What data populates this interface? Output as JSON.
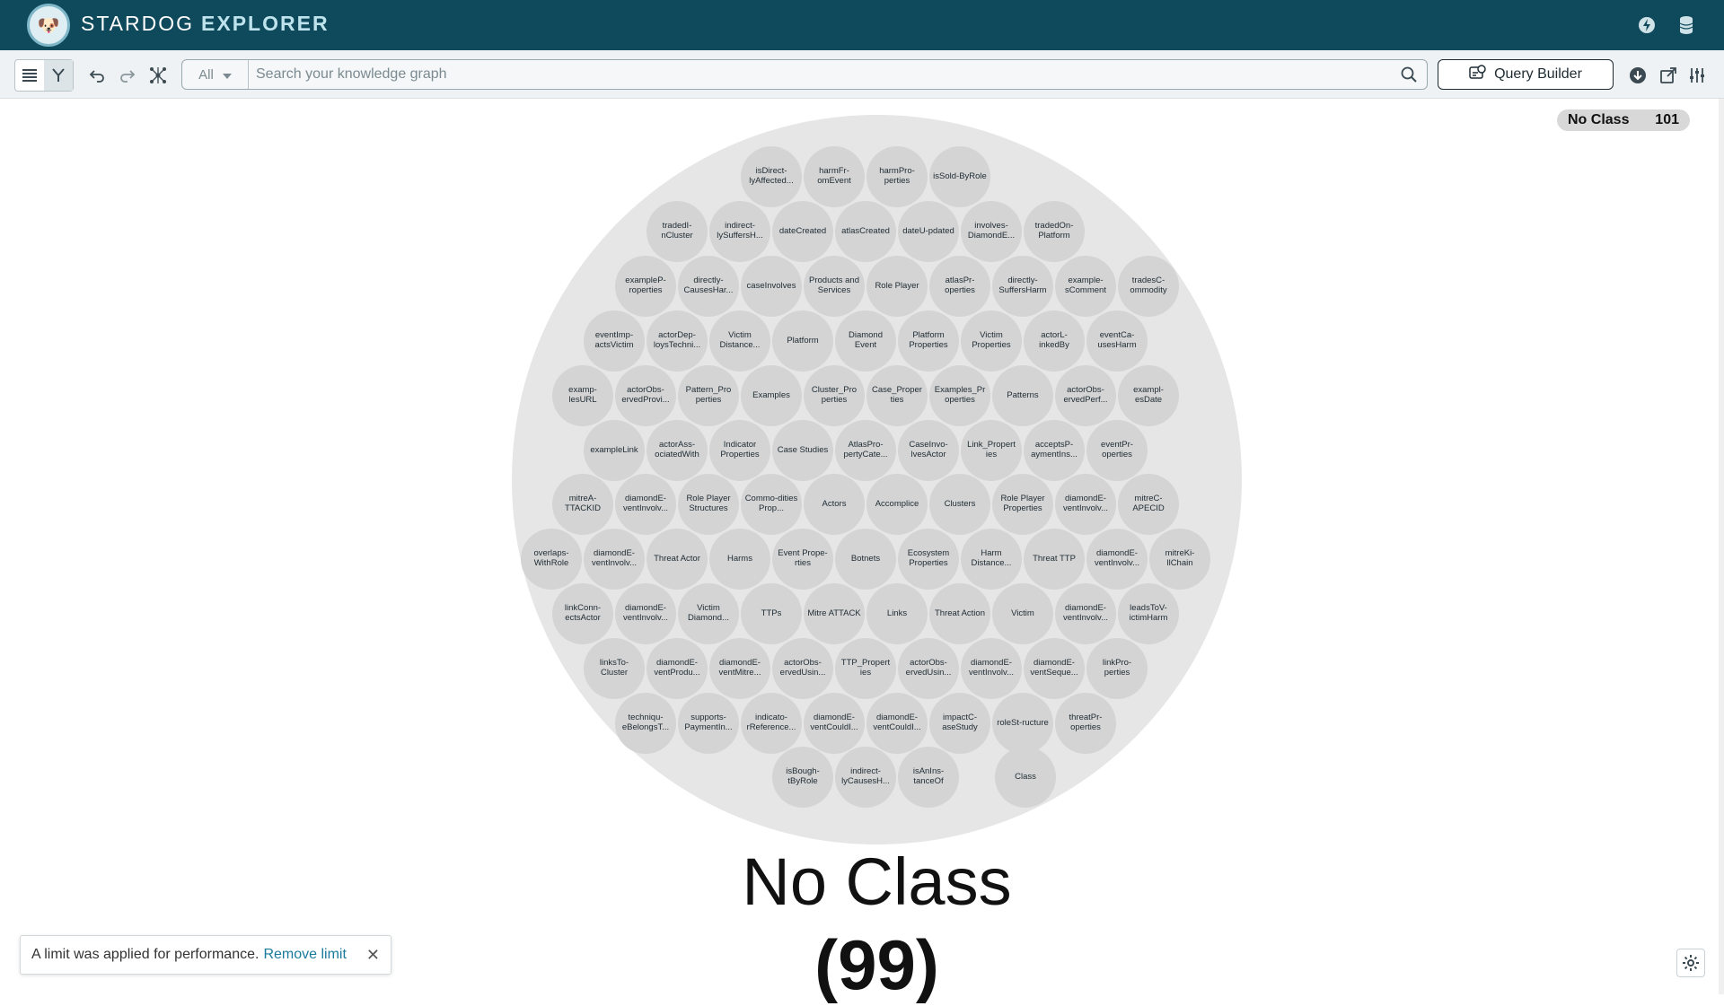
{
  "app": {
    "brand_light": "STARDOG",
    "brand_bold": "EXPLORER"
  },
  "search": {
    "scope": "All",
    "placeholder": "Search your knowledge graph"
  },
  "toolbar": {
    "query_builder": "Query Builder"
  },
  "badge": {
    "label": "No Class",
    "count": "101"
  },
  "cluster": {
    "title": "No Class",
    "count": "(99)"
  },
  "toast": {
    "message": "A limit was applied for performance.",
    "link": "Remove limit",
    "close": "✕"
  },
  "nodes": [
    "isDirect-lyAffected...",
    "harmFr-omEvent",
    "harmPro-perties",
    "isSold-ByRole",
    "tradedI-nCluster",
    "indirect-lySuffersH...",
    "dateCreated",
    "atlasCreated",
    "dateU-pdated",
    "involves-DiamondE...",
    "tradedOn-Platform",
    "exampleP-roperties",
    "directly-CausesHar...",
    "caseInvolves",
    "Products and Services",
    "Role Player",
    "atlasPr-operties",
    "directly-SuffersHarm",
    "example-sComment",
    "tradesC-ommodity",
    "eventImp-actsVictim",
    "actorDep-loysTechni...",
    "Victim Distance...",
    "Platform",
    "Diamond Event",
    "Platform Properties",
    "Victim Properties",
    "actorL-inkedBy",
    "eventCa-usesHarm",
    "examp-lesURL",
    "actorObs-ervedProvi...",
    "Pattern_Pro perties",
    "Examples",
    "Cluster_Pro perties",
    "Case_Proper ties",
    "Examples_Pr operties",
    "Patterns",
    "actorObs-ervedPerf...",
    "exampl-esDate",
    "exampleLink",
    "actorAss-ociatedWith",
    "Indicator Properties",
    "Case Studies",
    "AtlasPro-pertyCate...",
    "CaseInvo-lvesActor",
    "Link_Propert ies",
    "acceptsP-aymentIns...",
    "eventPr-operties",
    "mitreA-TTACKID",
    "diamondE-ventInvolv...",
    "Role Player Structures",
    "Commo-dities Prop...",
    "Actors",
    "Accomplice",
    "Clusters",
    "Role Player Properties",
    "diamondE-ventInvolv...",
    "mitreC-APECID",
    "overlaps-WithRole",
    "diamondE-ventInvolv...",
    "Threat Actor",
    "Harms",
    "Event Prope-rties",
    "Botnets",
    "Ecosystem Properties",
    "Harm Distance...",
    "Threat TTP",
    "diamondE-ventInvolv...",
    "mitreKi-llChain",
    "linkConn-ectsActor",
    "diamondE-ventInvolv...",
    "Victim Diamond...",
    "TTPs",
    "Mitre ATTACK",
    "Links",
    "Threat Action",
    "Victim",
    "diamondE-ventInvolv...",
    "leadsToV-ictimHarm",
    "linksTo-Cluster",
    "diamondE-ventProdu...",
    "diamondE-ventMitre...",
    "actorObs-ervedUsin...",
    "TTP_Propert ies",
    "actorObs-ervedUsin...",
    "diamondE-ventInvolv...",
    "diamondE-ventSeque...",
    "linkPro-perties",
    "techniqu-eBelongsT...",
    "supports-PaymentIn...",
    "indicato-rReference...",
    "diamondE-ventCouldI...",
    "diamondE-ventCouldI...",
    "impactC-aseStudy",
    "roleSt-ructure",
    "threatPr-operties",
    "isBough-tByRole",
    "indirect-lyCausesH...",
    "isAnIns-tanceOf",
    "Class"
  ]
}
